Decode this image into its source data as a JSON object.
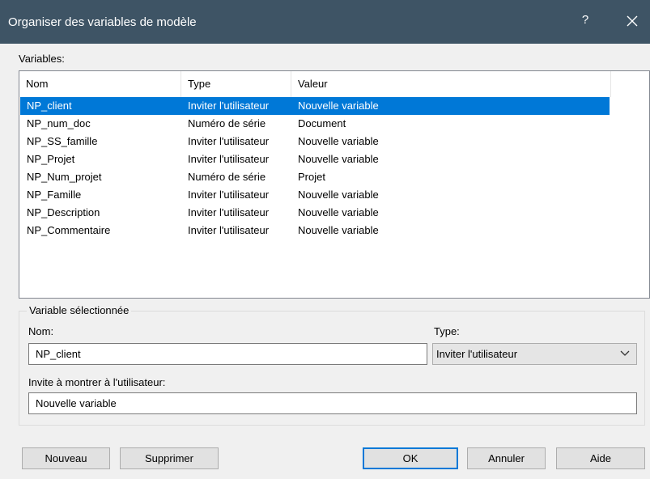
{
  "window": {
    "title": "Organiser des variables de modèle",
    "help_label": "?"
  },
  "variables_label": "Variables:",
  "columns": [
    "Nom",
    "Type",
    "Valeur"
  ],
  "rows": [
    {
      "nom": "NP_client",
      "type": "Inviter l'utilisateur",
      "valeur": "Nouvelle variable"
    },
    {
      "nom": "NP_num_doc",
      "type": "Numéro de série",
      "valeur": "Document"
    },
    {
      "nom": "NP_SS_famille",
      "type": "Inviter l'utilisateur",
      "valeur": "Nouvelle variable"
    },
    {
      "nom": "NP_Projet",
      "type": "Inviter l'utilisateur",
      "valeur": "Nouvelle variable"
    },
    {
      "nom": "NP_Num_projet",
      "type": "Numéro de série",
      "valeur": "Projet"
    },
    {
      "nom": "NP_Famille",
      "type": "Inviter l'utilisateur",
      "valeur": "Nouvelle variable"
    },
    {
      "nom": "NP_Description",
      "type": "Inviter l'utilisateur",
      "valeur": "Nouvelle variable"
    },
    {
      "nom": "NP_Commentaire",
      "type": "Inviter l'utilisateur",
      "valeur": "Nouvelle variable"
    }
  ],
  "selected_index": 0,
  "selected_group": {
    "title": "Variable sélectionnée",
    "nom_label": "Nom:",
    "nom_value": "NP_client",
    "type_label": "Type:",
    "type_value": "Inviter l'utilisateur",
    "prompt_label": "Invite à montrer à l'utilisateur:",
    "prompt_value": "Nouvelle variable"
  },
  "buttons": {
    "new": "Nouveau",
    "delete": "Supprimer",
    "ok": "OK",
    "cancel": "Annuler",
    "help": "Aide"
  },
  "colors": {
    "titlebar": "#3e5465",
    "selection": "#0078d7"
  },
  "icons": {
    "close": "close-icon",
    "dropdown": "chevron-down-icon"
  }
}
